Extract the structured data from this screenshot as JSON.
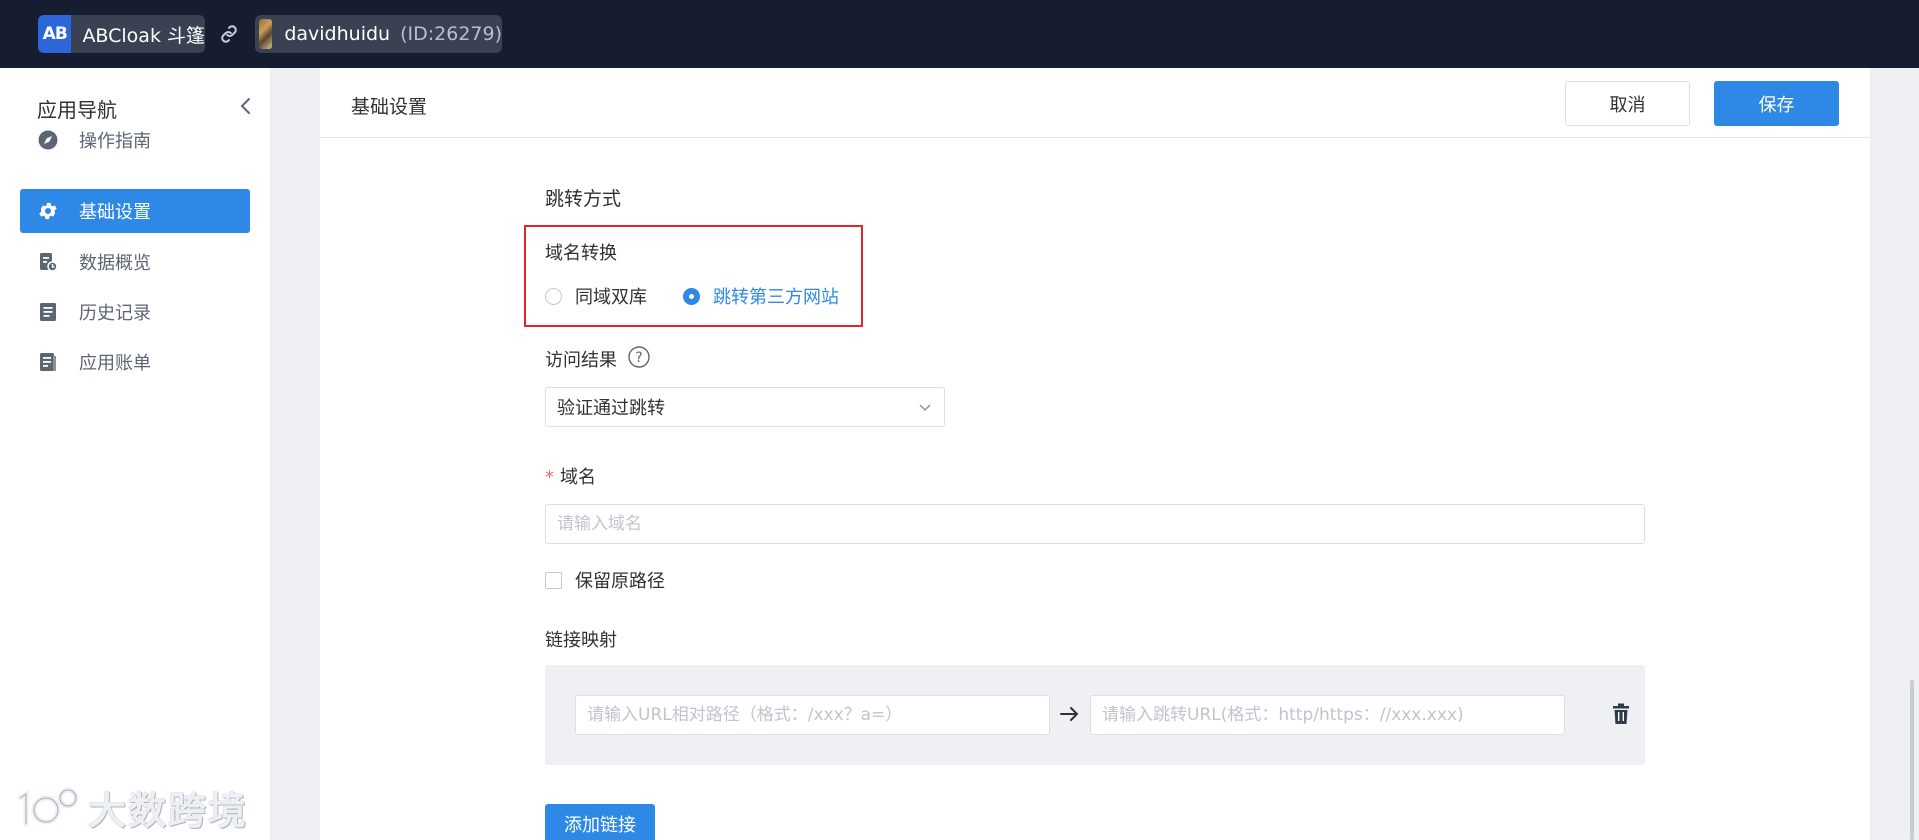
{
  "topbar": {
    "app_logo": "AB",
    "app_name": "ABCloak 斗篷",
    "user_name": "davidhuidu",
    "user_id": "(ID:26279)"
  },
  "sidebar": {
    "title": "应用导航",
    "items": [
      {
        "label": "操作指南",
        "icon": "compass-icon"
      },
      {
        "label": "基础设置",
        "icon": "gear-icon"
      },
      {
        "label": "数据概览",
        "icon": "data-report-icon"
      },
      {
        "label": "历史记录",
        "icon": "document-icon"
      },
      {
        "label": "应用账单",
        "icon": "bill-icon"
      }
    ]
  },
  "watermark": {
    "text": "大数跨境"
  },
  "header": {
    "title": "基础设置",
    "cancel_label": "取消",
    "save_label": "保存"
  },
  "form": {
    "section_title": "跳转方式",
    "domain_conversion": {
      "label": "域名转换",
      "options": [
        "同域双库",
        "跳转第三方网站"
      ],
      "selected": "跳转第三方网站"
    },
    "access_result": {
      "label": "访问结果",
      "value": "验证通过跳转"
    },
    "domain": {
      "required_mark": "*",
      "label": "域名",
      "placeholder": "请输入域名"
    },
    "keep_path": {
      "label": "保留原路径",
      "checked": false
    },
    "link_mapping": {
      "label": "链接映射",
      "path_placeholder": "请输入URL相对路径（格式：/xxx？a=）",
      "target_placeholder": "请输入跳转URL(格式：http/https：//xxx.xxx)"
    },
    "add_link_label": "添加链接"
  },
  "colors": {
    "primary": "#2e89e6",
    "topbar": "#161d31",
    "highlight_border": "#e0262b"
  }
}
